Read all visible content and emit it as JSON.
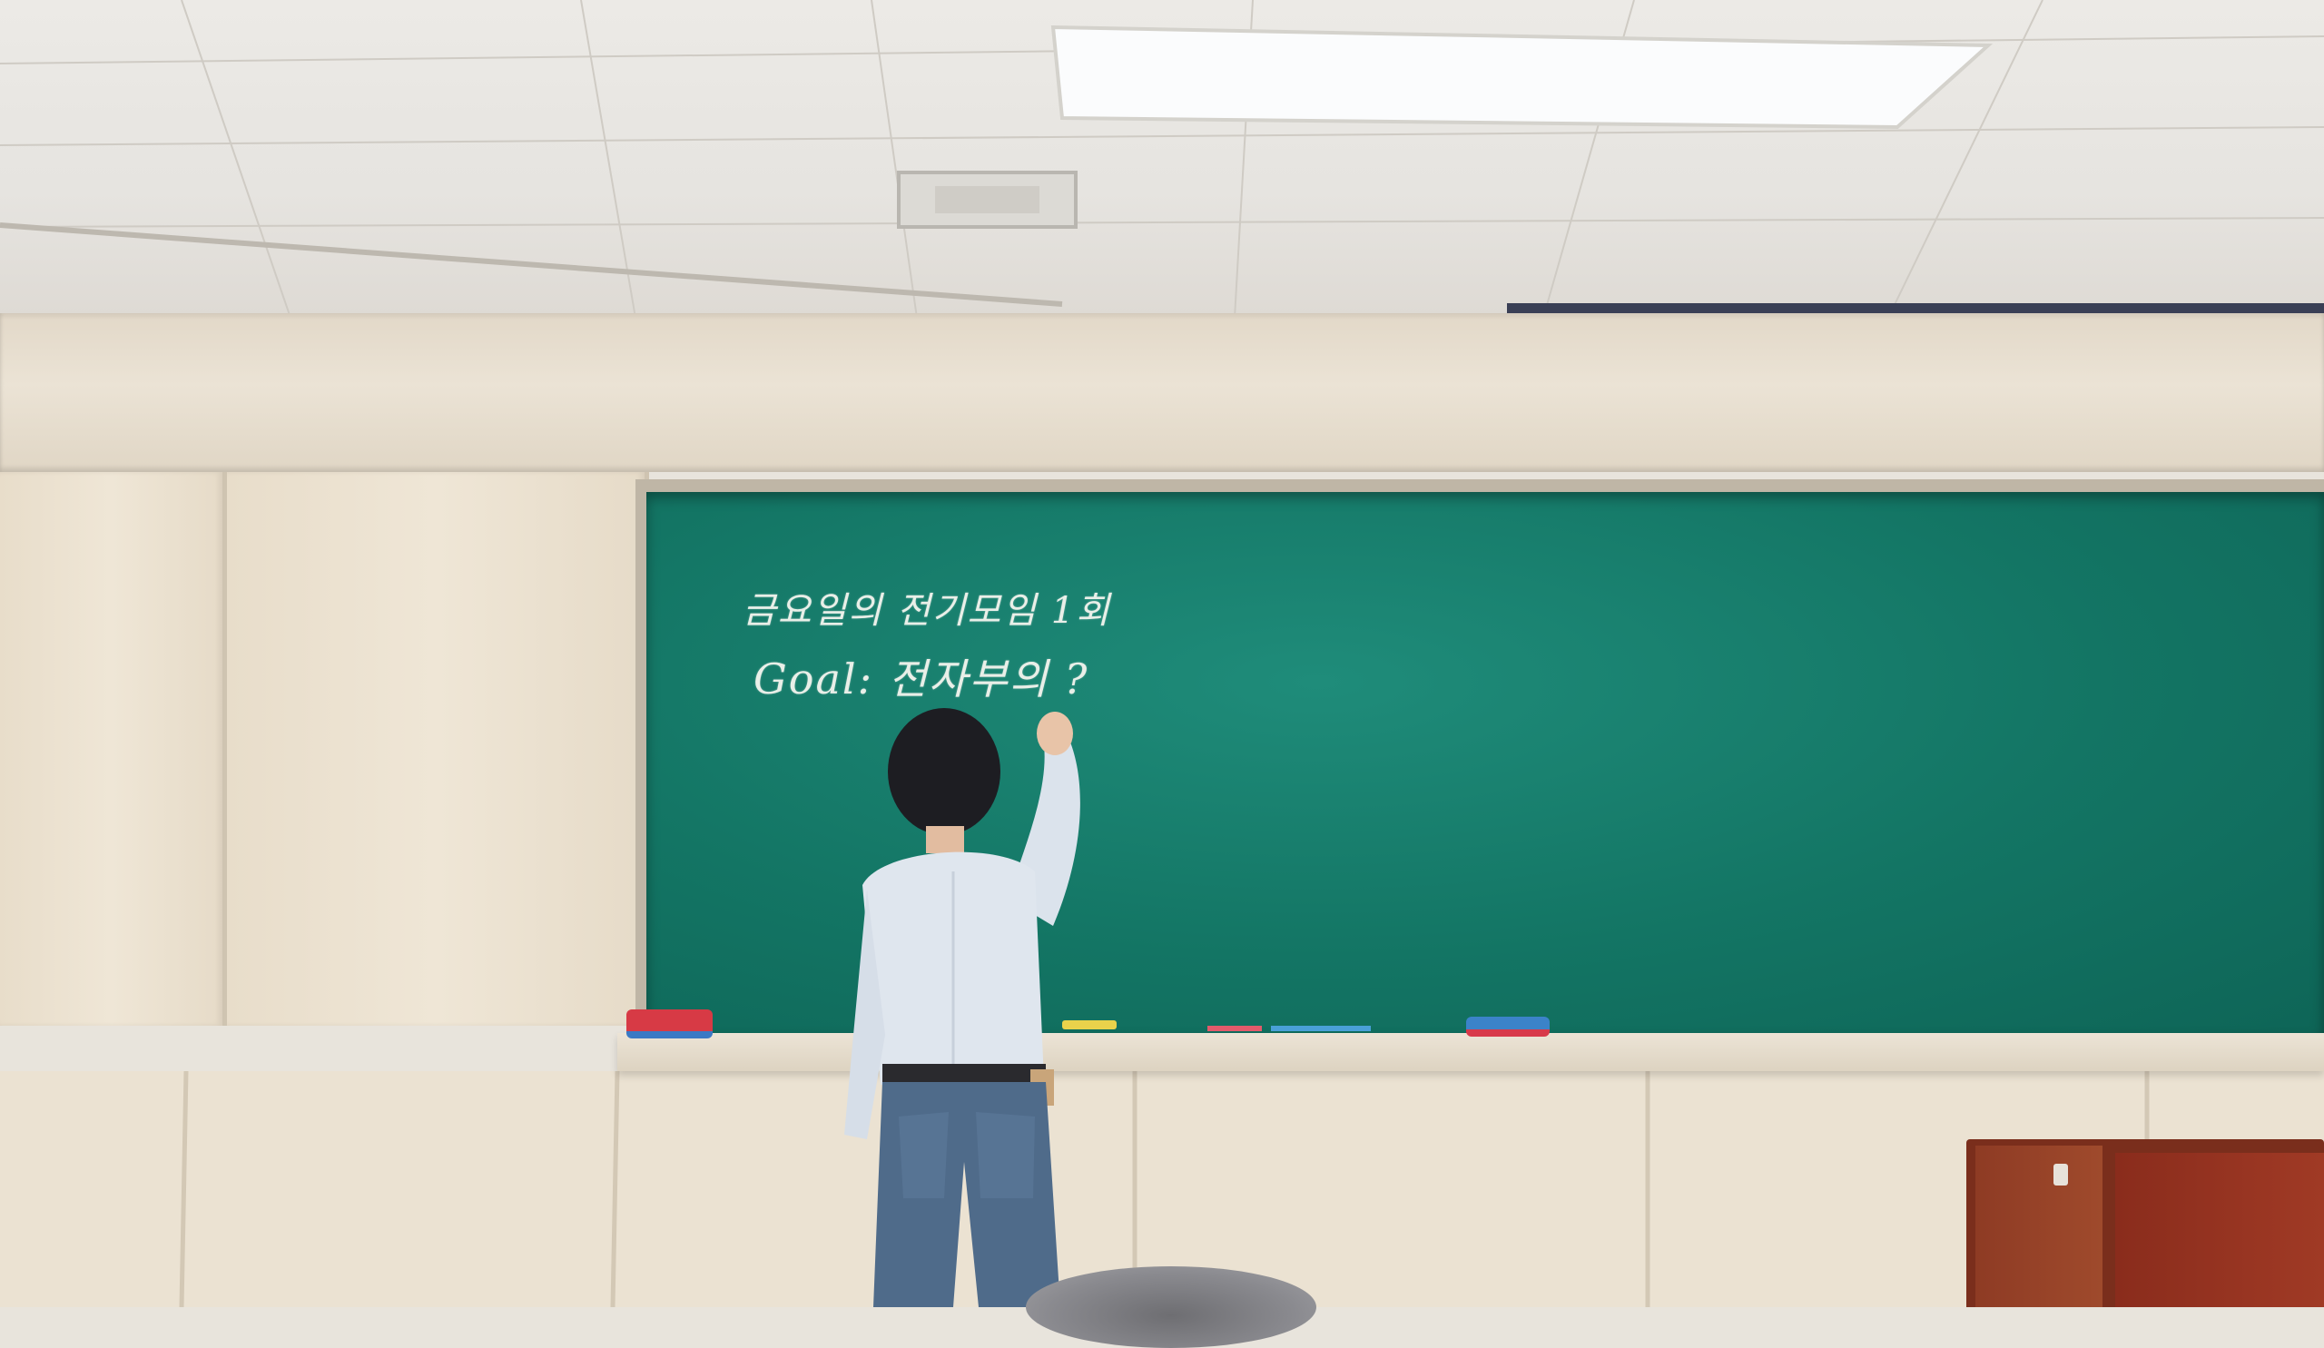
{
  "scene": {
    "description_role": "photo",
    "board_text": {
      "line1": "금요일의 전기모임 1회",
      "line2": "Goal: 전자부의 ?"
    }
  },
  "colors": {
    "board": "#137564",
    "chalk": "#e9efe8",
    "wall_wood": "#ebe2d2",
    "door": "#8a2c1c",
    "shirt": "#dfe6ee",
    "jeans": "#4f6b8a"
  }
}
